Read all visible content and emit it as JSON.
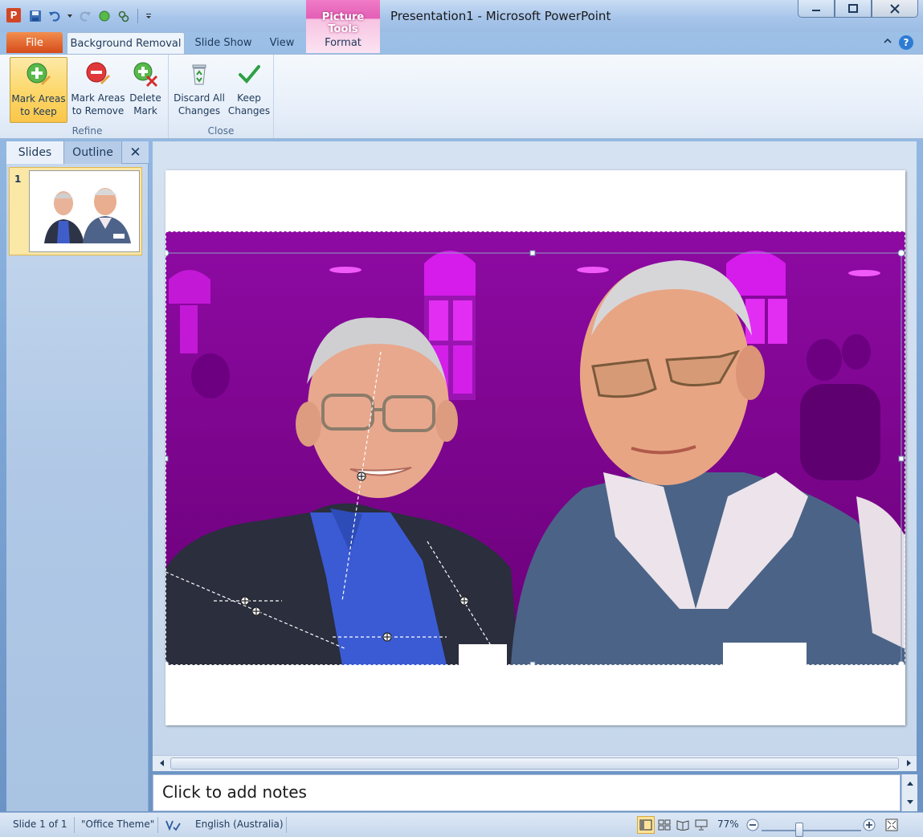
{
  "window": {
    "title": "Presentation1  -  Microsoft PowerPoint",
    "app_icon_letter": "P",
    "context_tab_group": "Picture Tools"
  },
  "quick_access": {
    "icons": [
      "save-icon",
      "undo-icon",
      "undo-dropdown-icon",
      "redo-icon",
      "record-icon",
      "link-icon",
      "customize-qat-icon"
    ]
  },
  "tabs": {
    "file": "File",
    "background_removal": "Background Removal",
    "slide_show": "Slide Show",
    "view": "View",
    "format": "Format",
    "help": "?"
  },
  "ribbon": {
    "refine": {
      "label": "Refine",
      "mark_keep": [
        "Mark Areas",
        "to Keep"
      ],
      "mark_remove": [
        "Mark Areas",
        "to Remove"
      ],
      "delete_mark": [
        "Delete",
        "Mark"
      ]
    },
    "close": {
      "label": "Close",
      "discard": [
        "Discard All",
        "Changes"
      ],
      "keep": [
        "Keep",
        "Changes"
      ]
    }
  },
  "slides_panel": {
    "tab_slides": "Slides",
    "tab_outline": "Outline",
    "close_glyph": "✕",
    "thumbnail_number": "1"
  },
  "notes": {
    "placeholder": "Click to add notes"
  },
  "status": {
    "slide": "Slide 1 of 1",
    "theme": "\"Office Theme\"",
    "language": "English (Australia)",
    "zoom": "77%",
    "zoom_level_percent": 77
  },
  "colors": {
    "remove_overlay": "#a000b4",
    "accent_ribbon_active": "#fcd86d",
    "file_tab": "#d54b1a"
  }
}
